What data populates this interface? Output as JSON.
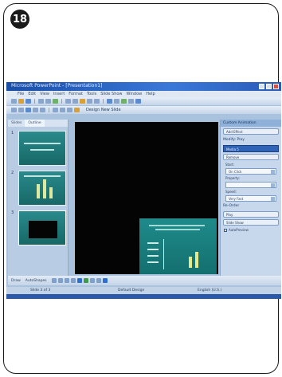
{
  "figure": {
    "step_number": "18"
  },
  "window": {
    "title": "Microsoft PowerPoint - [Presentation1]",
    "menu": [
      "File",
      "Edit",
      "View",
      "Insert",
      "Format",
      "Tools",
      "Slide Show",
      "Window",
      "Help"
    ],
    "toolbar_text": "Design  New Slide"
  },
  "slide_pane": {
    "tabs": [
      "Slides",
      "Outline"
    ],
    "slides": [
      "1",
      "2",
      "3"
    ]
  },
  "task_pane": {
    "header": "Custom Animation",
    "add_effect": "Add Effect",
    "remove": "Remove",
    "modify_label": "Modify: Play",
    "start_label": "Start:",
    "start_value": "On Click",
    "property_label": "Property:",
    "property_value": "",
    "speed_label": "Speed:",
    "speed_value": "Very Fast",
    "selected_item": "Media 5",
    "reorder_label": "Re-Order",
    "play_button": "Play",
    "slideshow_button": "Slide Show",
    "autopreview_label": "AutoPreview"
  },
  "notes_bar": {
    "draw_label": "Draw",
    "autoshapes_label": "AutoShapes"
  },
  "status_bar": {
    "slide_info": "Slide 3 of 3",
    "design": "Default Design",
    "language": "English (U.S.)"
  },
  "colors": {
    "title_bar": "#2a5cb8",
    "stage": "#040404",
    "slide_theme": "#1f8a8a",
    "task_pane": "#c8d8ec"
  }
}
